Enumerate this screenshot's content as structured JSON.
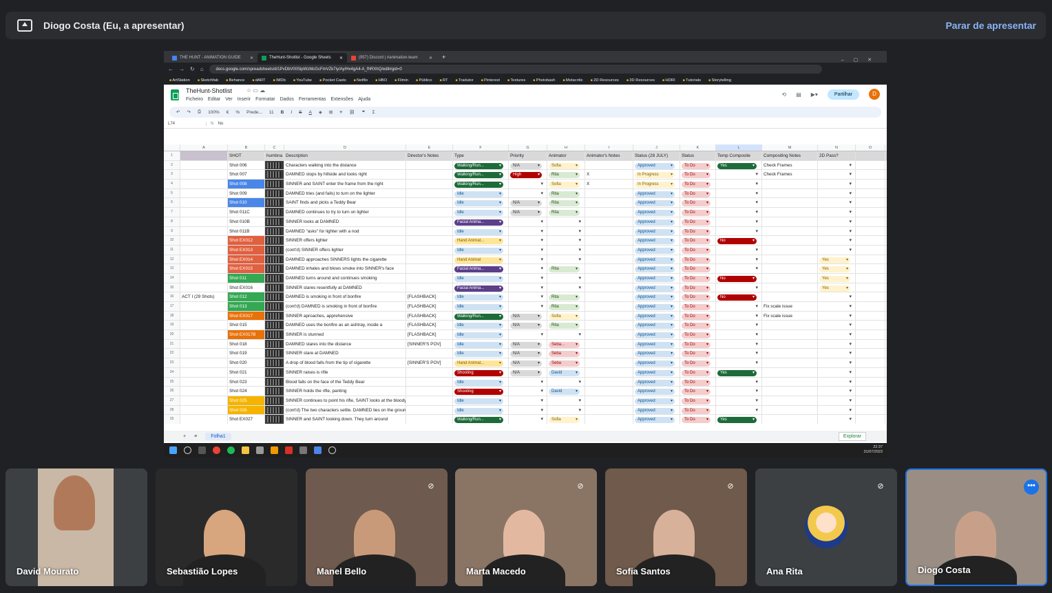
{
  "presenter_bar": {
    "name": "Diogo Costa (Eu, a apresentar)",
    "stop_label": "Parar de apresentar"
  },
  "browser": {
    "tabs": [
      {
        "title": "THE HUNT - ANIMATION GUIDE",
        "color": "#4285f4"
      },
      {
        "title": "TheHunt-Shotlist - Google Sheets",
        "color": "#0f9d58"
      },
      {
        "title": "(957) Discord | #animation-team",
        "color": "#ea4335"
      }
    ],
    "url": "docs.google.com/spreadsheets/d/1PvDbV00SipWzMcGcFmVZk7iy/Ay/Hx4gA4-A_fhRXhQ/edit#gid=0",
    "bookmarks": [
      "ArtStation",
      "Sketchfab",
      "Behance",
      "dART",
      "IMDb",
      "YouTube",
      "Pocket Casts",
      "Netflix",
      "HBO",
      "Filmin",
      "Público",
      "RT",
      "Tradutor",
      "Pinterest",
      "Textures",
      "Photobash",
      "Metacritic",
      "2D Resources",
      "3D Resources",
      "HDRI",
      "Tutorials",
      "Storytelling"
    ]
  },
  "sheet": {
    "title": "TheHunt-Shotlist",
    "menu": [
      "Ficheiro",
      "Editar",
      "Ver",
      "Inserir",
      "Formatar",
      "Dados",
      "Ferramentas",
      "Extensões",
      "Ajuda"
    ],
    "share_label": "Partilhar",
    "avatar_letter": "D",
    "toolbar": {
      "zoom": "100%",
      "font": "Prede...",
      "font_size": "11"
    },
    "cell_ref": "L74",
    "formula_value": "No",
    "column_letters": [
      "A",
      "B",
      "C",
      "D",
      "E",
      "F",
      "G",
      "H",
      "I",
      "J",
      "K",
      "L",
      "M",
      "N",
      "O"
    ],
    "headers": [
      "",
      "SHOT",
      "humbna",
      "Description",
      "Director's Notes",
      "Type",
      "Priority",
      "Animator",
      "Animator's Notes",
      "Status (28 JULY)",
      "Status",
      "Temp Composite",
      "Compositing Notes",
      "2D Pass?",
      ""
    ],
    "act_label": "ACT I (29 Shots)",
    "rows": [
      [
        "Shot 006",
        "",
        "Characters walking into the distance",
        "",
        "Walking/Run...",
        "N/A",
        "Sofia",
        "",
        "Approved",
        "To Do",
        "Yes",
        "Check Frames",
        ""
      ],
      [
        "Shot 007",
        "",
        "DAMNED stops by hillside and looks right",
        "",
        "Walking/Run...",
        "High",
        "Rita",
        "X",
        "In Progress",
        "To Do",
        "",
        "Check Frames",
        ""
      ],
      [
        "Shot 008",
        "",
        "SINNER and SAINT enter the frame from the right",
        "",
        "Walking/Run...",
        "",
        "Sofia",
        "X",
        "In Progress",
        "To Do",
        "",
        "",
        ""
      ],
      [
        "Shot 009",
        "",
        "DAMNED tries (and fails) to turn on the lighter",
        "",
        "Idle",
        "",
        "Rita",
        "",
        "Approved",
        "To Do",
        "",
        "",
        ""
      ],
      [
        "Shot 010",
        "",
        "SAINT finds and picks a Teddy Bear",
        "",
        "Idle",
        "N/A",
        "Rita",
        "",
        "Approved",
        "To Do",
        "",
        "",
        ""
      ],
      [
        "Shot 011C",
        "",
        "DAMNED continues to try to turn on lighter",
        "",
        "Idle",
        "N/A",
        "Rita",
        "",
        "Approved",
        "To Do",
        "",
        "",
        ""
      ],
      [
        "Shot 010B",
        "",
        "SINNER looks at DAMNED",
        "",
        "Facial Anima...",
        "",
        "",
        "",
        "Approved",
        "To Do",
        "",
        "",
        ""
      ],
      [
        "Shot 011B",
        "",
        "DAMNED \"asks\" for lighter with a nod",
        "",
        "Idle",
        "",
        "",
        "",
        "Approved",
        "To Do",
        "",
        "",
        ""
      ],
      [
        "Shot EX012",
        "",
        "SINNER offers lighter",
        "",
        "Hand Animat...",
        "",
        "",
        "",
        "Approved",
        "To Do",
        "No",
        "",
        ""
      ],
      [
        "Shot EX013",
        "",
        "(cont'd) SINNER offers lighter",
        "",
        "Idle",
        "",
        "",
        "",
        "Approved",
        "To Do",
        "",
        "",
        ""
      ],
      [
        "Shot EX014",
        "",
        "DAMNED approaches SINNERS lights the cigarette",
        "",
        "Hand Animat",
        "",
        "",
        "",
        "Approved",
        "To Do",
        "",
        "",
        "Yes"
      ],
      [
        "Shot EX015",
        "",
        "DAMNED inhales and blows smoke into SINNER's face",
        "",
        "Facial Anima...",
        "",
        "Rita",
        "",
        "Approved",
        "To Do",
        "",
        "",
        "Yes"
      ],
      [
        "Shot 011",
        "",
        "DAMNED turns around and continues smoking",
        "",
        "Idle",
        "",
        "",
        "",
        "Approved",
        "To Do",
        "No",
        "",
        "Yes"
      ],
      [
        "Shot EX016",
        "",
        "SINNER stares resentfully at DAMNED",
        "",
        "Facial Anima...",
        "",
        "",
        "",
        "Approved",
        "To Do",
        "",
        "",
        "Yes"
      ],
      [
        "Shot 012",
        "",
        "DAMNED is smoking in front of bonfire",
        "[FLASHBACK]",
        "Idle",
        "",
        "Rita",
        "",
        "Approved",
        "To Do",
        "No",
        "",
        ""
      ],
      [
        "Shot 013",
        "",
        "(cont'd) DAMNED is smoking in front of bonfire",
        "[FLASHBACK]",
        "Idle",
        "",
        "Rita",
        "",
        "Approved",
        "To Do",
        "",
        "Fix scale issue",
        ""
      ],
      [
        "Shot EX017",
        "",
        "SINNER aproaches, apprehensive",
        "[FLASHBACK]",
        "Walking/Run...",
        "N/A",
        "Sofia",
        "",
        "Approved",
        "To Do",
        "",
        "Fix scale issue",
        ""
      ],
      [
        "Shot 015",
        "",
        "DAMNED uses the bonfire as an ashtray, inside a",
        "[FLASHBACK]",
        "Idle",
        "N/A",
        "Rita",
        "",
        "Approved",
        "To Do",
        "",
        "",
        ""
      ],
      [
        "Shot EX017B",
        "",
        "SINNER is stunned",
        "[FLASHBACK]",
        "Idle",
        "",
        "",
        "",
        "Approved",
        "To Do",
        "",
        "",
        ""
      ],
      [
        "Shot 018",
        "",
        "DAMNED stares into the distance",
        "[SINNER'S POV]",
        "Idle",
        "N/A",
        "Seba...",
        "",
        "Approved",
        "To Do",
        "",
        "",
        ""
      ],
      [
        "Shot 019",
        "",
        "SINNER stare at DAMNED",
        "",
        "Idle",
        "N/A",
        "Seba",
        "",
        "Approved",
        "To Do",
        "",
        "",
        ""
      ],
      [
        "Shot 020",
        "",
        "A drop of blood falls from the tip of cigarette",
        "[SINNER'S POV]",
        "Hand Animat...",
        "N/A",
        "Seba",
        "",
        "Approved",
        "To Do",
        "",
        "",
        ""
      ],
      [
        "Shot 021",
        "",
        "SINNER raises is rifle",
        "",
        "Shooting",
        "N/A",
        "David",
        "",
        "Approved",
        "To Do",
        "Yes",
        "",
        ""
      ],
      [
        "Shot 023",
        "",
        "Blood falls on the face of the Teddy Bear",
        "",
        "Idle",
        "",
        "",
        "",
        "Approved",
        "To Do",
        "",
        "",
        ""
      ],
      [
        "Shot 024",
        "",
        "SINNER holds the rifle, panting",
        "",
        "Shooting",
        "",
        "David",
        "",
        "Approved",
        "To Do",
        "",
        "",
        ""
      ],
      [
        "Shot 025",
        "",
        "SINNER continues to point his rifle, SAINT looks at the bloody Tedd",
        "",
        "Idle",
        "",
        "",
        "",
        "Approved",
        "To Do",
        "",
        "",
        ""
      ],
      [
        "Shot 026",
        "",
        "(cont'd) The two characters settle. DAMNED lies on the ground",
        "",
        "Idle",
        "",
        "",
        "",
        "Approved",
        "To Do",
        "",
        "",
        ""
      ],
      [
        "Shot EX027",
        "",
        "SINNER and SAINT looking down. They turn around",
        "",
        "Walking/Run...",
        "",
        "Sofia",
        "",
        "Approved",
        "To Do",
        "Yes",
        "",
        ""
      ]
    ],
    "shot_colors": [
      "",
      "",
      "#4a86e8",
      "",
      "#4a86e8",
      "",
      "",
      "",
      "#e06040",
      "#e06040",
      "#e06040",
      "#e06040",
      "#34a853",
      "",
      "#34a853",
      "#34a853",
      "#e8710a",
      "",
      "#e8710a",
      "",
      "",
      "",
      "",
      "",
      "",
      "#f4b400",
      "#f4b400",
      ""
    ],
    "sheet_tab": "Folha1",
    "explore_label": "Explorar"
  },
  "taskbar": {
    "time": "22:37",
    "date": "31/07/2023"
  },
  "participants": [
    {
      "name": "David Mourato",
      "muted": false,
      "bg": "#c9b8a6",
      "skin": "#b07a5a"
    },
    {
      "name": "Sebastião Lopes",
      "muted": false,
      "bg": "#2a2a2a",
      "skin": "#d7a67e"
    },
    {
      "name": "Manel Bello",
      "muted": true,
      "bg": "#6e5a4e",
      "skin": "#c99a7a"
    },
    {
      "name": "Marta Macedo",
      "muted": true,
      "bg": "#8a7565",
      "skin": "#e2b9a0"
    },
    {
      "name": "Sofia Santos",
      "muted": true,
      "bg": "#6f5a4b",
      "skin": "#d8b19a"
    },
    {
      "name": "Ana Rita",
      "muted": true,
      "bg": "#3c4043",
      "skin": ""
    },
    {
      "name": "Diogo Costa",
      "muted": false,
      "bg": "#9a8e84",
      "skin": "#c8a08a"
    }
  ]
}
